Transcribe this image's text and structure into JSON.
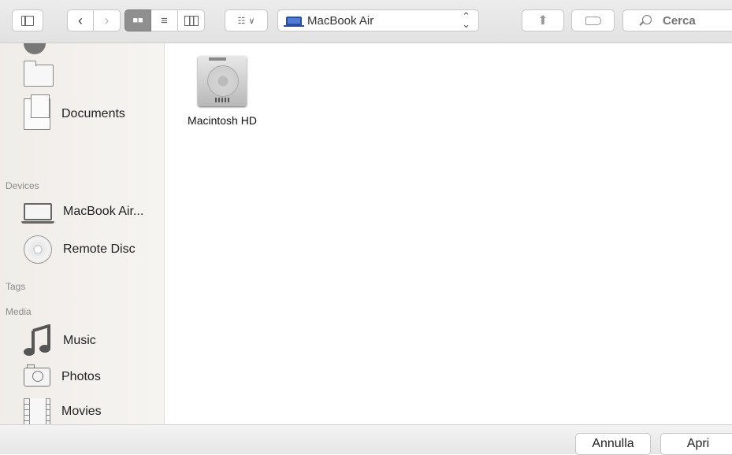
{
  "toolbar": {
    "location_name": "MacBook Air",
    "search_placeholder": "Cerca",
    "search_value": ""
  },
  "sidebar": {
    "headers": {
      "devices": "Devices",
      "tags": "Tags",
      "media": "Media"
    },
    "favorites": [
      {
        "label": "",
        "icon": "folder-icon"
      },
      {
        "label": "Documents",
        "icon": "document-icon"
      }
    ],
    "devices": [
      {
        "label": "MacBook Air...",
        "icon": "laptop-icon"
      },
      {
        "label": "Remote Disc",
        "icon": "disc-icon"
      }
    ],
    "media": [
      {
        "label": "Music",
        "icon": "music-note-icon"
      },
      {
        "label": "Photos",
        "icon": "camera-icon"
      },
      {
        "label": "Movies",
        "icon": "film-icon"
      }
    ]
  },
  "main": {
    "items": [
      {
        "name": "Macintosh HD",
        "icon": "hard-drive-icon"
      }
    ]
  },
  "footer": {
    "cancel_label": "Annulla",
    "open_label": "Apri"
  }
}
